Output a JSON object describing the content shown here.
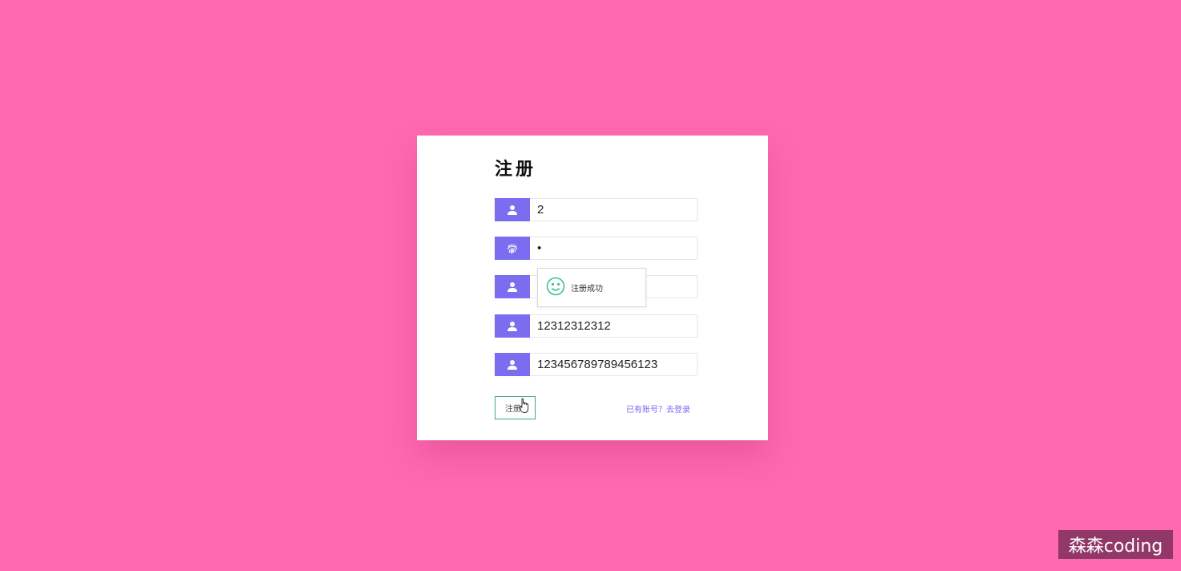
{
  "page": {
    "background_color": "#ff69b0",
    "accent_color": "#7b6cf0",
    "success_color": "#3dbf9a"
  },
  "form": {
    "title": "注册",
    "fields": [
      {
        "icon": "user-icon",
        "value": "2"
      },
      {
        "icon": "fingerprint-icon",
        "value": "•"
      },
      {
        "icon": "user-icon",
        "value": ""
      },
      {
        "icon": "user-icon",
        "value": "12312312312"
      },
      {
        "icon": "user-icon",
        "value": "123456789789456123"
      }
    ],
    "submit_label": "注册",
    "login_link": "已有账号？去登录"
  },
  "toast": {
    "icon": "smile-icon",
    "message": "注册成功"
  },
  "watermark": {
    "text": "森森coding"
  }
}
